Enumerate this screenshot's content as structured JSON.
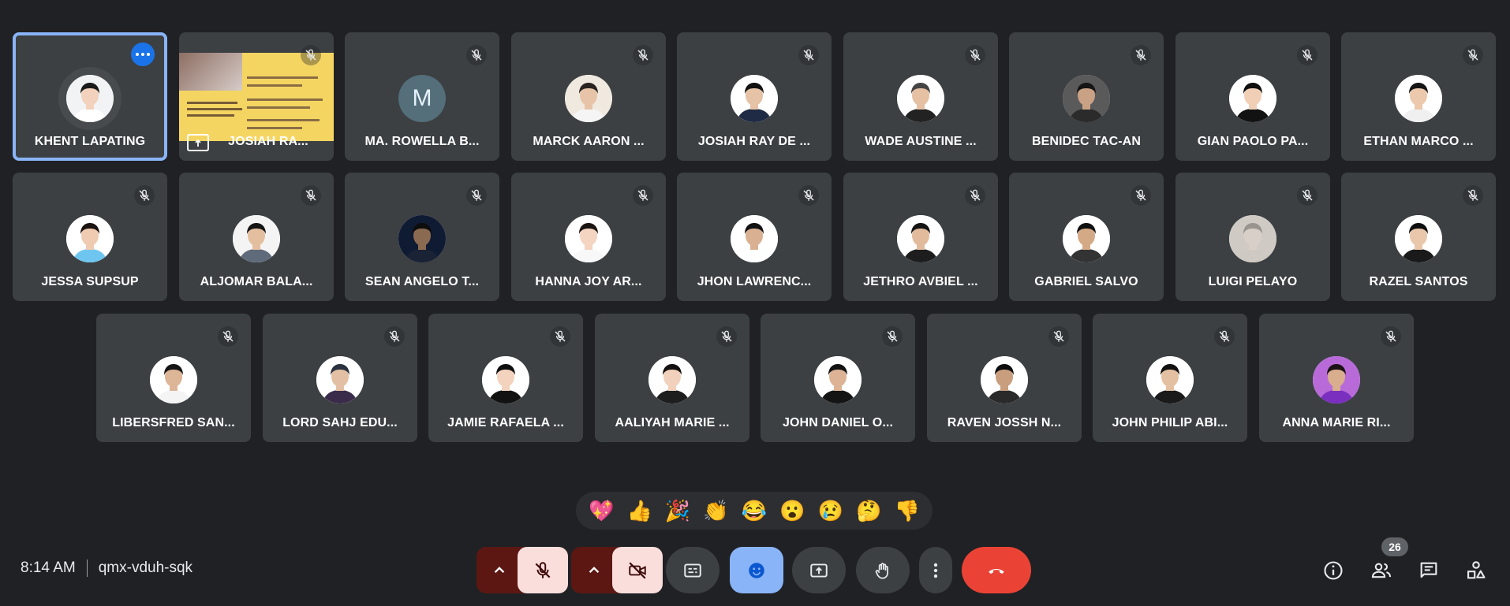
{
  "participants": [
    {
      "name": "KHENT LAPATING",
      "skin": "#f2d2bd",
      "hair": "#1b1b1b",
      "shirt": "#ffffff",
      "bg": "#f1f3f4",
      "active": true
    },
    {
      "name": "JOSIAH RA...",
      "presenting": true
    },
    {
      "name": "MA. ROWELLA B...",
      "letter": "M"
    },
    {
      "name": "MARCK AARON ...",
      "skin": "#e7c4a8",
      "hair": "#2a2420",
      "shirt": "#f5f5f5",
      "bg": "#efe9e0"
    },
    {
      "name": "JOSIAH RAY DE ...",
      "skin": "#e6c2a6",
      "hair": "#111111",
      "shirt": "#1f2a44",
      "bg": "#ffffff"
    },
    {
      "name": "WADE AUSTINE ...",
      "skin": "#e5c0a3",
      "hair": "#444444",
      "shirt": "#222222",
      "bg": "#ffffff"
    },
    {
      "name": "BENIDEC TAC-AN",
      "skin": "#c9a184",
      "hair": "#151515",
      "shirt": "#2b2b2b",
      "bg": "#5a5a5a"
    },
    {
      "name": "GIAN PAOLO PA...",
      "skin": "#f0cfb6",
      "hair": "#0f0f0f",
      "shirt": "#121212",
      "bg": "#ffffff"
    },
    {
      "name": "ETHAN MARCO ...",
      "skin": "#ecc8ac",
      "hair": "#151515",
      "shirt": "#f0f0f0",
      "bg": "#ffffff"
    },
    {
      "name": "JESSA SUPSUP",
      "skin": "#efcbb2",
      "hair": "#1b1410",
      "shirt": "#6ec6f0",
      "bg": "#ffffff"
    },
    {
      "name": "ALJOMAR BALA...",
      "skin": "#e3bfa0",
      "hair": "#151515",
      "shirt": "#5f6b7a",
      "bg": "#f4f4f4"
    },
    {
      "name": "SEAN ANGELO T...",
      "skin": "#8b6a52",
      "hair": "#0d0d0d",
      "shirt": "#1a2236",
      "bg": "#0f1a33"
    },
    {
      "name": "HANNA JOY AR...",
      "skin": "#f3d5c1",
      "hair": "#1c1411",
      "shirt": "#f8f8f8",
      "bg": "#ffffff"
    },
    {
      "name": "JHON LAWRENC...",
      "skin": "#d9b092",
      "hair": "#121212",
      "shirt": "#ffffff",
      "bg": "#ffffff"
    },
    {
      "name": "JETHRO AVBIEL ...",
      "skin": "#e2bb9d",
      "hair": "#141414",
      "shirt": "#1d1d1d",
      "bg": "#ffffff"
    },
    {
      "name": "GABRIEL SALVO",
      "skin": "#d4a986",
      "hair": "#101010",
      "shirt": "#333333",
      "bg": "#ffffff"
    },
    {
      "name": "LUIGI PELAYO",
      "skin": "#d8d0c8",
      "hair": "#9a948e",
      "shirt": "#cfc9c3",
      "bg": "#cfcac4"
    },
    {
      "name": "RAZEL SANTOS",
      "skin": "#e9c7ab",
      "hair": "#0f0f0f",
      "shirt": "#1a1a1a",
      "bg": "#ffffff"
    },
    {
      "name": "LIBERSFRED SAN...",
      "skin": "#ddb597",
      "hair": "#141414",
      "shirt": "#f4f4f4",
      "bg": "#ffffff"
    },
    {
      "name": "LORD SAHJ EDU...",
      "skin": "#e3c0a4",
      "hair": "#2a3240",
      "shirt": "#3b2b4a",
      "bg": "#ffffff"
    },
    {
      "name": "JAMIE RAFAELA ...",
      "skin": "#f3d3be",
      "hair": "#0e0e0e",
      "shirt": "#121212",
      "bg": "#ffffff"
    },
    {
      "name": "AALIYAH MARIE ...",
      "skin": "#f1d1bc",
      "hair": "#151010",
      "shirt": "#1e1e1e",
      "bg": "#ffffff"
    },
    {
      "name": "JOHN DANIEL O...",
      "skin": "#dcb395",
      "hair": "#121212",
      "shirt": "#141414",
      "bg": "#ffffff"
    },
    {
      "name": "RAVEN JOSSH N...",
      "skin": "#c99e7e",
      "hair": "#0d0d0d",
      "shirt": "#2a2a2a",
      "bg": "#ffffff"
    },
    {
      "name": "JOHN PHILIP ABI...",
      "skin": "#e4c0a2",
      "hair": "#111111",
      "shirt": "#1a1a1a",
      "bg": "#ffffff"
    },
    {
      "name": "ANNA MARIE RI...",
      "skin": "#d9ae8e",
      "hair": "#1c1216",
      "shirt": "#7b2fbe",
      "bg": "#b96ad9"
    }
  ],
  "meeting": {
    "time": "8:14 AM",
    "code": "qmx-vduh-sqk"
  },
  "participant_count": "26",
  "reactions": [
    "💖",
    "👍",
    "🎉",
    "👏",
    "😂",
    "😮",
    "😢",
    "🤔",
    "👎"
  ],
  "colors": {
    "background": "#202124",
    "tile": "#3c4043",
    "leave": "#ea4335",
    "accent": "#8ab4f8"
  },
  "controls": {
    "mic": "mic-off-icon",
    "camera": "videocam-off-icon",
    "captions": "closed-caption-icon",
    "emoji": "emoji-icon",
    "present": "present-to-all-icon",
    "raise_hand": "hand-icon",
    "more": "more-vert-icon",
    "leave": "call-end-icon"
  },
  "side_controls": [
    "info-icon",
    "people-icon",
    "chat-icon",
    "activities-icon"
  ]
}
